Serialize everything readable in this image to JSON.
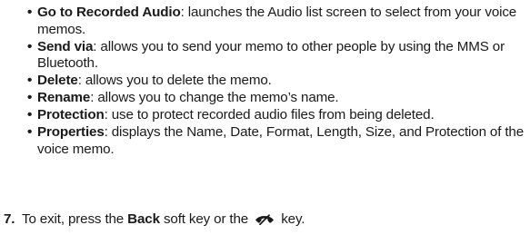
{
  "options": [
    {
      "term": "Go to Recorded Audio",
      "text": ": launches the Audio list screen to select from your voice memos."
    },
    {
      "term": "Send via",
      "text": ": allows you to send your memo to other people by using the MMS or Bluetooth."
    },
    {
      "term": "Delete",
      "text": ": allows you to delete the memo."
    },
    {
      "term": "Rename",
      "text": ": allows you to change the memo’s name."
    },
    {
      "term": "Protection",
      "text": ": use to protect recorded audio files from being deleted."
    },
    {
      "term": "Properties",
      "text": ": displays the Name, Date, Format, Length, Size, and Protection of the voice memo."
    }
  ],
  "bullet_glyph": "•",
  "step": {
    "number": "7.",
    "text_before": "To exit, press the ",
    "bold_word": "Back",
    "text_middle": " soft key or the ",
    "icon": "end-call-key-icon",
    "text_after": " key."
  }
}
